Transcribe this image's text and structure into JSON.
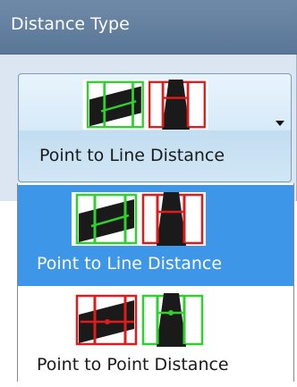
{
  "group": {
    "title": "Distance Type"
  },
  "combo": {
    "selected_label": "Point to Line Distance",
    "arrow_icon": "chevron-down-icon"
  },
  "dropdown": {
    "options": [
      {
        "label": "Point to Line Distance",
        "icon": "point-to-line-icon",
        "selected": true
      },
      {
        "label": "Point to Point Distance",
        "icon": "point-to-point-icon",
        "selected": false
      }
    ]
  },
  "colors": {
    "header_bg": "#6a86a5",
    "selection": "#3d96e8",
    "marker_green": "#2fd12f",
    "marker_red": "#e01b1b"
  }
}
